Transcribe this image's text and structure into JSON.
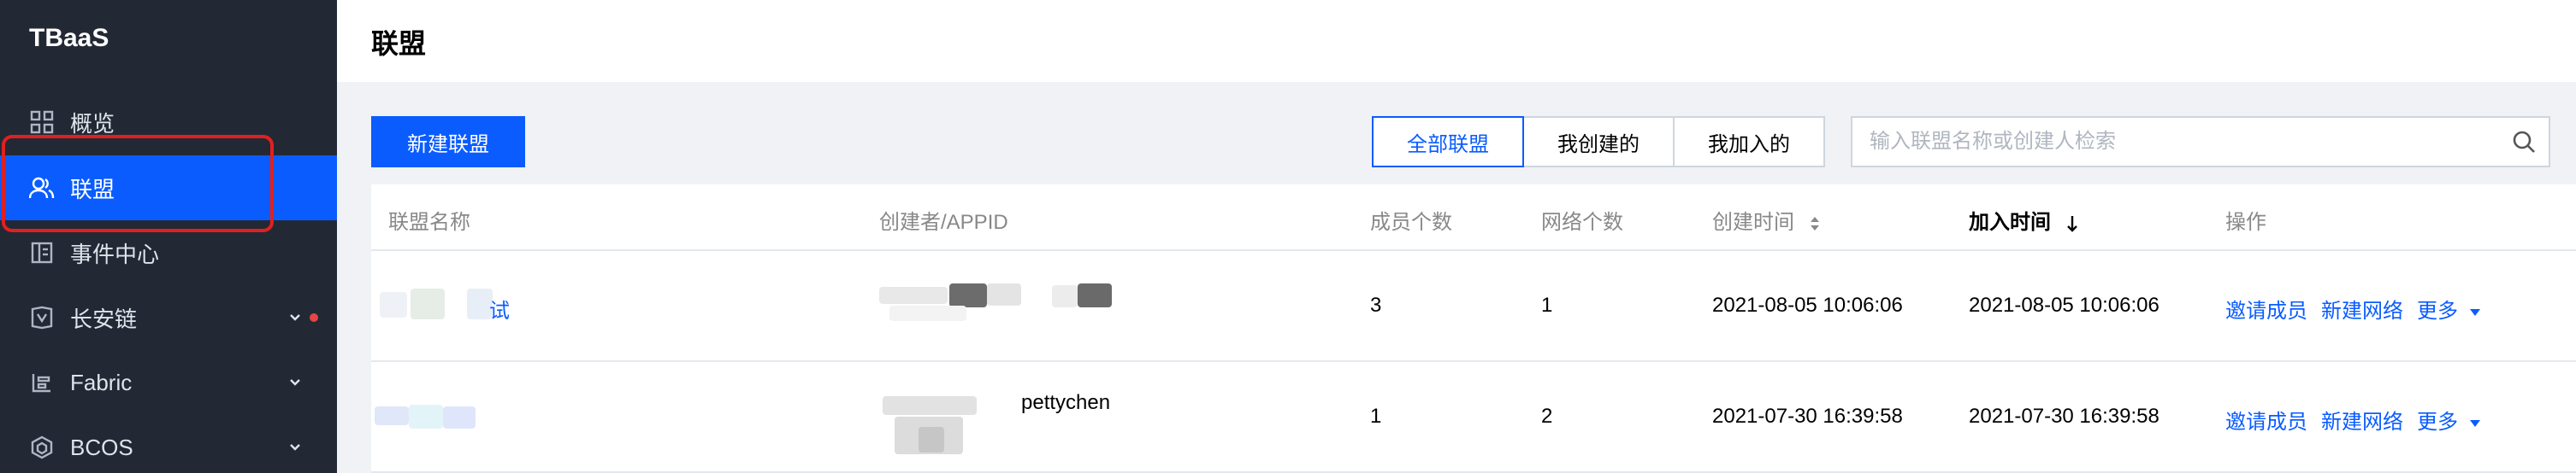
{
  "app": {
    "name": "TBaaS"
  },
  "sidebar": {
    "items": [
      {
        "label": "概览",
        "icon": "dashboard-icon"
      },
      {
        "label": "联盟",
        "icon": "users-icon",
        "active": true
      },
      {
        "label": "事件中心",
        "icon": "event-icon"
      },
      {
        "label": "长安链",
        "icon": "chain-icon",
        "expandable": true,
        "badge": "red-dot"
      },
      {
        "label": "Fabric",
        "icon": "fabric-icon",
        "expandable": true
      },
      {
        "label": "BCOS",
        "icon": "bcos-icon",
        "expandable": true
      }
    ]
  },
  "header": {
    "title": "联盟"
  },
  "toolbar": {
    "create_label": "新建联盟",
    "filters": [
      "全部联盟",
      "我创建的",
      "我加入的"
    ],
    "active_filter": "全部联盟",
    "search_placeholder": "输入联盟名称或创建人检索",
    "search_value": ""
  },
  "table": {
    "columns": [
      "联盟名称",
      "创建者/APPID",
      "成员个数",
      "网络个数",
      "创建时间",
      "加入时间",
      "操作"
    ],
    "rows": [
      {
        "name": "试",
        "creator": "",
        "members": "3",
        "networks": "1",
        "created": "2021-08-05 10:06:06",
        "joined": "2021-08-05 10:06:06",
        "actions": [
          "邀请成员",
          "新建网络",
          "更多"
        ]
      },
      {
        "name": "",
        "creator": "pettychen",
        "members": "1",
        "networks": "2",
        "created": "2021-07-30 16:39:58",
        "joined": "2021-07-30 16:39:58",
        "actions": [
          "邀请成员",
          "新建网络",
          "更多"
        ]
      }
    ]
  },
  "colors": {
    "accent": "#0a5cff",
    "sidebar_bg": "#222935",
    "highlight_box": "#e02020"
  }
}
